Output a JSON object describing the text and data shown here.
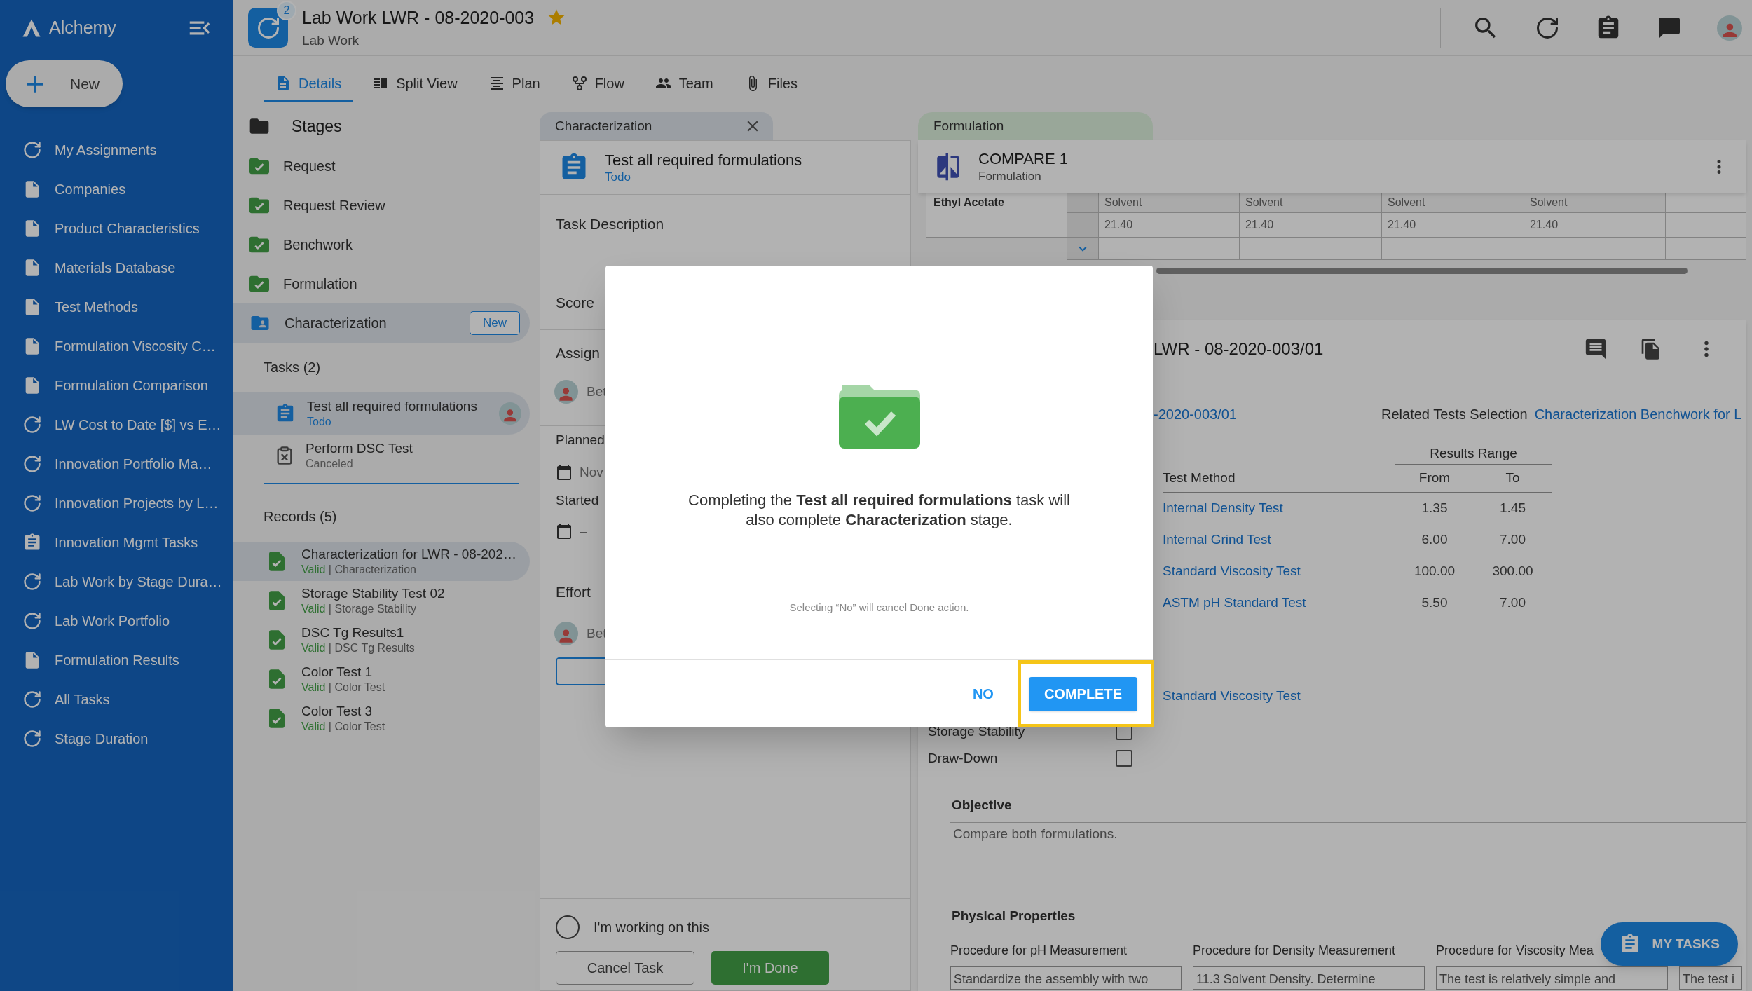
{
  "sidebar": {
    "logo": "Alchemy",
    "new_button": "New",
    "items": [
      {
        "label": "My Assignments",
        "kind": "report"
      },
      {
        "label": "Companies",
        "kind": "document"
      },
      {
        "label": "Product Characteristics",
        "kind": "document"
      },
      {
        "label": "Materials Database",
        "kind": "document"
      },
      {
        "label": "Test Methods",
        "kind": "document"
      },
      {
        "label": "Formulation Viscosity C…",
        "kind": "document"
      },
      {
        "label": "Formulation Comparison",
        "kind": "document"
      },
      {
        "label": "LW Cost to Date [$] vs E…",
        "kind": "report"
      },
      {
        "label": "Innovation Portfolio Ma…",
        "kind": "report"
      },
      {
        "label": "Innovation Projects by L…",
        "kind": "report"
      },
      {
        "label": "Innovation Mgmt Tasks",
        "kind": "tasks"
      },
      {
        "label": "Lab Work by Stage Dura…",
        "kind": "report"
      },
      {
        "label": "Lab Work Portfolio",
        "kind": "report"
      },
      {
        "label": "Formulation Results",
        "kind": "document"
      },
      {
        "label": "All Tasks",
        "kind": "report"
      },
      {
        "label": "Stage Duration",
        "kind": "report"
      }
    ]
  },
  "header": {
    "badge": "2",
    "title": "Lab Work LWR - 08-2020-003",
    "subtitle": "Lab Work",
    "starred": true
  },
  "tabs": [
    {
      "label": "Details",
      "selected": true
    },
    {
      "label": "Split View",
      "selected": false
    },
    {
      "label": "Plan",
      "selected": false
    },
    {
      "label": "Flow",
      "selected": false
    },
    {
      "label": "Team",
      "selected": false
    },
    {
      "label": "Files",
      "selected": false
    }
  ],
  "stages": {
    "title": "Stages",
    "items": [
      {
        "label": "Request",
        "kind": "done",
        "selected": false
      },
      {
        "label": "Request Review",
        "kind": "done",
        "selected": false
      },
      {
        "label": "Benchwork",
        "kind": "done",
        "selected": false
      },
      {
        "label": "Formulation",
        "kind": "done",
        "selected": false
      },
      {
        "label": "Characterization",
        "kind": "active",
        "selected": true,
        "badge": "New"
      }
    ]
  },
  "tasks": {
    "title": "Tasks (2)",
    "items": [
      {
        "title": "Test all required formulations",
        "status": "Todo",
        "kind": "todo",
        "selected": true,
        "assigned": true
      },
      {
        "title": "Perform DSC Test",
        "status": "Canceled",
        "kind": "canceled",
        "selected": false,
        "assigned": false
      }
    ]
  },
  "records": {
    "title": "Records (5)",
    "separator": "|",
    "items": [
      {
        "title": "Characterization for LWR - 08-202…",
        "status": "Valid",
        "type": "Characterization",
        "selected": true
      },
      {
        "title": "Storage Stability Test 02",
        "status": "Valid",
        "type": "Storage Stability",
        "selected": false
      },
      {
        "title": "DSC Tg Results1",
        "status": "Valid",
        "type": "DSC Tg Results",
        "selected": false
      },
      {
        "title": "Color Test 1",
        "status": "Valid",
        "type": "Color Test",
        "selected": false
      },
      {
        "title": "Color Test 3",
        "status": "Valid",
        "type": "Color Test",
        "selected": false
      }
    ]
  },
  "task_panel": {
    "tab": "Characterization",
    "title": "Test all required formulations",
    "status": "Todo",
    "description_label": "Task Description",
    "score_label": "Score",
    "assignee_label": "Assign",
    "assignee_name": "Bet",
    "planned_label": "Planned",
    "planned_date": "Nov",
    "started_label": "Started",
    "started_date": "–",
    "effort_label": "Effort",
    "effort_name": "Bet",
    "working": {
      "label": "I'm working on this",
      "checked": false
    },
    "cancel_button": "Cancel Task",
    "done_button": "I'm Done"
  },
  "formulation_panel": {
    "tab": "Formulation",
    "title": "COMPARE 1",
    "subtitle": "Formulation",
    "row_label": "Ethyl Acetate",
    "columns": [
      {
        "type": "Solvent",
        "value": "21.40"
      },
      {
        "type": "Solvent",
        "value": "21.40"
      },
      {
        "type": "Solvent",
        "value": "21.40"
      },
      {
        "type": "Solvent",
        "value": "21.40"
      }
    ]
  },
  "record_panel": {
    "title": "LWR - 08-2020-003/01",
    "id_value": "-2020-003/01",
    "related_label": "Related Tests Selection",
    "related_value": "Characterization Benchwork for L",
    "results_range": "Results Range",
    "columns": [
      "Test Method",
      "From",
      "To"
    ],
    "rows": [
      {
        "method": "Internal Density Test",
        "from": "1.35",
        "to": "1.45"
      },
      {
        "method": "Internal Grind Test",
        "from": "6.00",
        "to": "7.00"
      },
      {
        "method": "Standard Viscosity Test",
        "from": "100.00",
        "to": "300.00"
      },
      {
        "method": "ASTM pH Standard Test",
        "from": "5.50",
        "to": "7.00"
      }
    ],
    "extra_link": "Standard Viscosity Test",
    "checks": [
      {
        "label": "Storage Stability",
        "checked": false
      },
      {
        "label": "Draw-Down",
        "checked": false
      }
    ],
    "objective_label": "Objective",
    "objective_value": "Compare both formulations.",
    "physical_title": "Physical Properties",
    "procedures": [
      {
        "label": "Procedure for pH Measurement",
        "text": "Standardize the assembly with two"
      },
      {
        "label": "Procedure for Density Measurement",
        "text": "11.3 Solvent Density. Determine"
      },
      {
        "label": "Procedure for Viscosity Mea",
        "text": "The test is relatively simple and"
      },
      {
        "text": "The test i"
      }
    ]
  },
  "fab": {
    "label": "MY TASKS"
  },
  "dialog": {
    "message": "Completing the **Test all required formulations** task will also complete **Characterization** stage.",
    "note": "Selecting “No” will cancel Done action.",
    "buttons": [
      {
        "label": "NO",
        "kind": "text",
        "highlighted": false
      },
      {
        "label": "COMPLETE",
        "kind": "primary",
        "highlighted": true
      }
    ]
  }
}
